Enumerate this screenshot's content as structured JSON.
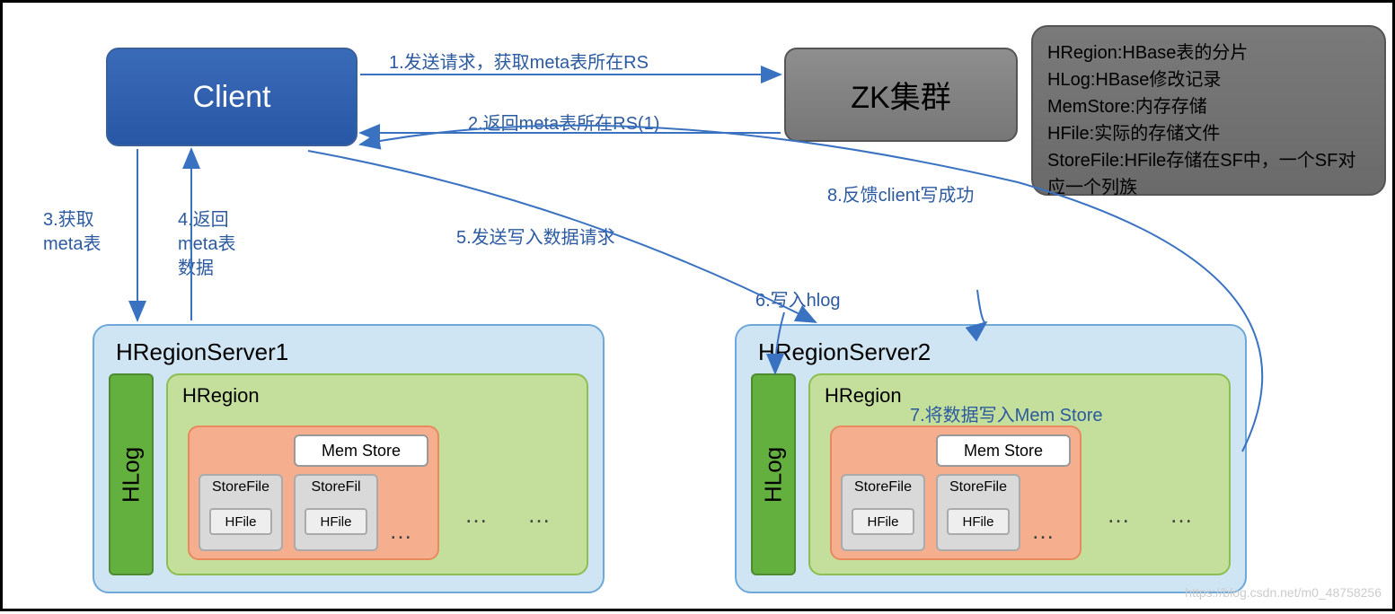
{
  "nodes": {
    "client": "Client",
    "zk": "ZK集群",
    "rs1": {
      "title": "HRegionServer1",
      "hlog": "HLog",
      "hregion": "HRegion",
      "memstore": "Mem Store",
      "sf1": "StoreFile",
      "sf2": "StoreFil",
      "hfile": "HFile"
    },
    "rs2": {
      "title": "HRegionServer2",
      "hlog": "HLog",
      "hregion": "HRegion",
      "memstore": "Mem Store",
      "sf1": "StoreFile",
      "sf2": "StoreFile",
      "hfile": "HFile"
    }
  },
  "legend": {
    "l1": "HRegion:HBase表的分片",
    "l2": "HLog:HBase修改记录",
    "l3": "MemStore:内存存储",
    "l4": "HFile:实际的存储文件",
    "l5": "StoreFile:HFile存储在SF中，一个SF对应一个列族"
  },
  "edges": {
    "e1": "1.发送请求，获取meta表所在RS",
    "e2": "2.返回meta表所在RS(1)",
    "e3a": "3.获取",
    "e3b": "meta表",
    "e4a": "4.返回",
    "e4b": "meta表",
    "e4c": "数据",
    "e5": "5.发送写入数据请求",
    "e6": "6.写入hlog",
    "e7": "7.将数据写入Mem Store",
    "e8": "8.反馈client写成功"
  },
  "dots": "…",
  "watermark": "https://blog.csdn.net/m0_48758256"
}
